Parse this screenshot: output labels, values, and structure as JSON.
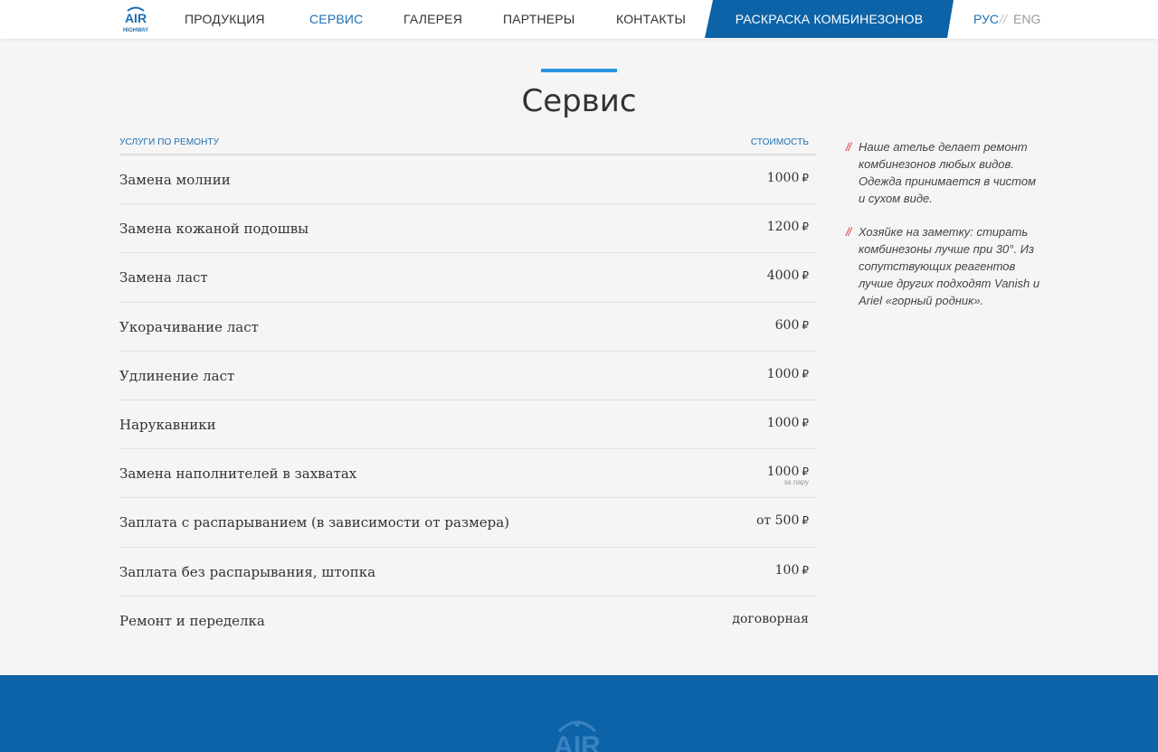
{
  "header": {
    "logo": {
      "top": "AIR",
      "bottom": "HIGHWAY",
      "color": "#1c6fb2"
    },
    "nav": [
      {
        "label": "ПРОДУКЦИЯ"
      },
      {
        "label": "СЕРВИС",
        "active": true
      },
      {
        "label": "ГАЛЕРЕЯ"
      },
      {
        "label": "ПАРТНЕРЫ"
      },
      {
        "label": "КОНТАКТЫ"
      }
    ],
    "promo": "РАСКРАСКА КОМБИНЕЗОНОВ",
    "lang": {
      "ru": "РУС",
      "sep": "//",
      "en": "ENG"
    }
  },
  "page": {
    "title": "Сервис"
  },
  "table": {
    "col_service": "услуги по ремонту",
    "col_price": "стоимость",
    "currency": "₽",
    "rows": [
      {
        "service": "Замена молнии",
        "price": "1000",
        "note": ""
      },
      {
        "service": "Замена кожаной подошвы",
        "price": "1200",
        "note": ""
      },
      {
        "service": "Замена ласт",
        "price": "4000",
        "note": ""
      },
      {
        "service": "Укорачивание ласт",
        "price": "600",
        "note": ""
      },
      {
        "service": "Удлинение ласт",
        "price": "1000",
        "note": ""
      },
      {
        "service": "Нарукавники",
        "price": "1000",
        "note": ""
      },
      {
        "service": "Замена наполнителей в захватах",
        "price": "1000",
        "note": "за пару"
      },
      {
        "service": "Заплата с распарыванием (в зависимости от размера)",
        "price": "от 500",
        "note": ""
      },
      {
        "service": "Заплата без распарывания, штопка",
        "price": "100",
        "note": ""
      },
      {
        "service": "Ремонт и переделка",
        "price": "договорная",
        "note": ""
      }
    ]
  },
  "notes": {
    "mark": "//",
    "items": [
      "Наше ателье делает ремонт комбинезонов любых видов. Одежда принимается в чистом и сухом виде.",
      "Хозяйке на заметку: стирать комбинезоны лучше при 30°. Из сопутствующих реагентов лучше других подходят Vanish и Ariel «горный родник»."
    ]
  },
  "colors": {
    "brand": "#0d63a7",
    "accent_bar": "#2b95e0",
    "note_mark": "#dd3333",
    "background": "#f5f5f5"
  }
}
